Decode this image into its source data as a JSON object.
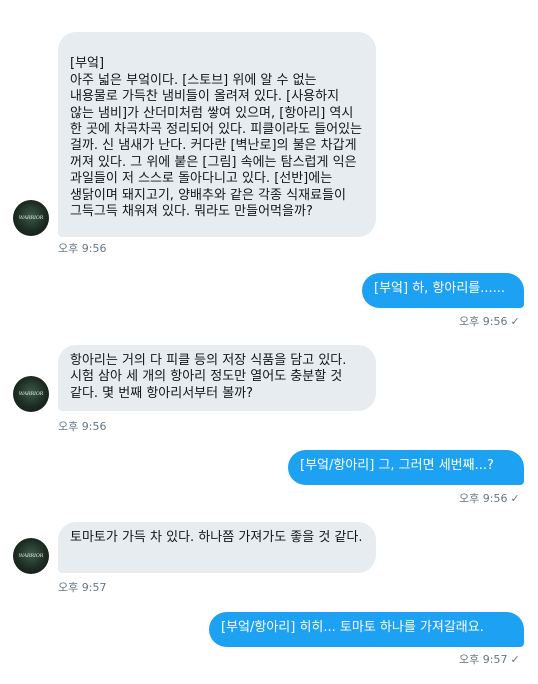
{
  "contact": {
    "avatar_text": "WARRIOR"
  },
  "messages": [
    {
      "direction": "in",
      "text": "[부엌]\n아주 넓은 부엌이다. [스토브] 위에 알 수 없는 내용물로 가득찬 냄비들이 올려져 있다. [사용하지 않는 냄비]가 산더미처럼 쌓여 있으며, [항아리] 역시 한 곳에 차곡차곡 정리되어 있다. 피클이라도 들어있는 걸까. 신 냄새가 난다. 커다란 [벽난로]의 불은 차갑게 꺼져 있다. 그 위에 붙은 [그림] 속에는 탐스럽게 익은 과일들이 저 스스로 돌아다니고 있다. [선반]에는 생닭이며 돼지고기, 양배추와 같은 각종 식재료들이 그득그득 채워져 있다. 뭐라도 만들어먹을까?",
      "time": "오후 9:56"
    },
    {
      "direction": "out",
      "text": "[부엌] 하, 항아리를......",
      "time": "오후 9:56",
      "status": "✓"
    },
    {
      "direction": "in",
      "text": "항아리는 거의 다 피클 등의 저장 식품을 담고 있다. 시험 삼아 세 개의 항아리 정도만 열어도 충분할 것 같다. 몇 번째 항아리서부터 볼까?",
      "time": "오후 9:56"
    },
    {
      "direction": "out",
      "text": "[부엌/항아리] 그, 그러면 세번째...?",
      "time": "오후 9:56",
      "status": "✓"
    },
    {
      "direction": "in",
      "text": "토마토가 가득 차 있다. 하나쯤 가져가도 좋을 것 같다.",
      "time": "오후 9:57"
    },
    {
      "direction": "out",
      "text": "[부엌/항아리] 히히... 토마토 하나를 가져갈래요.",
      "time": "오후 9:57",
      "status": "✓"
    }
  ]
}
